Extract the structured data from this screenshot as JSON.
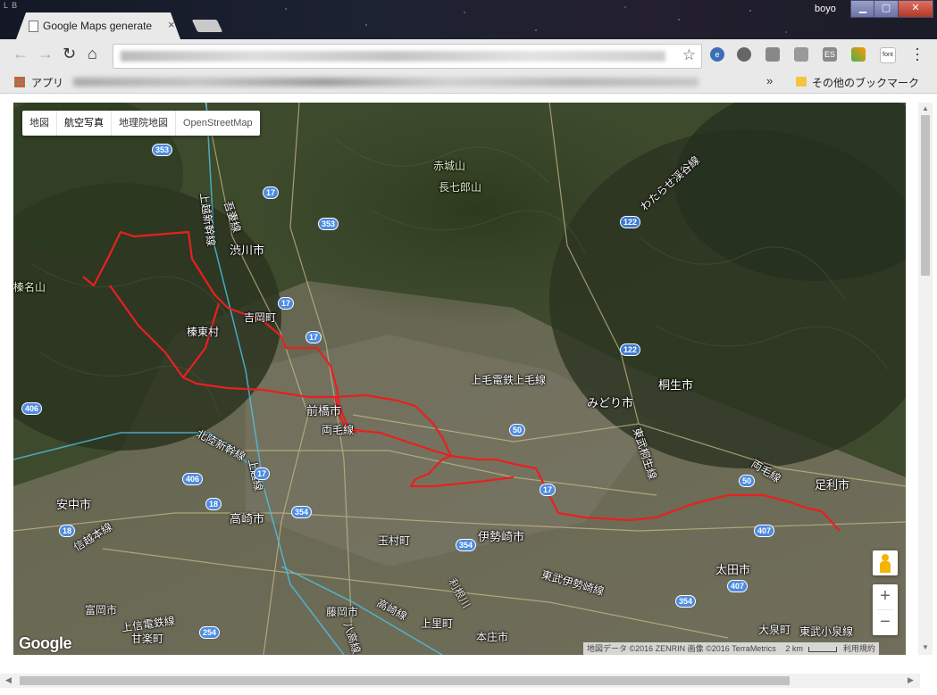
{
  "window": {
    "user": "boyo",
    "tab_title": "Google Maps generate",
    "tab_close": "×",
    "minimize": "▁",
    "maximize": "▢",
    "close": "✕"
  },
  "toolbar": {
    "back": "←",
    "forward": "→",
    "reload": "↻",
    "home": "⌂",
    "star": "☆",
    "ext_e": "e",
    "ext_es": "ES",
    "ext_font": "font"
  },
  "bookmarks": {
    "apps": "アプリ",
    "more": "»",
    "other": "その他のブックマーク"
  },
  "map": {
    "types": [
      "地図",
      "航空写真",
      "地理院地図",
      "OpenStreetMap"
    ],
    "selected_type": "航空写真",
    "google": "Google",
    "zoom_in": "+",
    "zoom_out": "−",
    "attribution": "地図データ ©2016 ZENRIN 画像 ©2016 TerraMetrics",
    "scale": "2 km",
    "terms": "利用規約",
    "labels": {
      "akagi": "赤城山",
      "nanashiro": "長七郎山",
      "haruna": "榛名山",
      "shibukawa": "渋川市",
      "yoshioka": "吉岡町",
      "shinto": "榛東村",
      "maebashi": "前橋市",
      "takasaki": "高崎市",
      "isesaki": "伊勢崎市",
      "midori": "みどり市",
      "kiryu": "桐生市",
      "ashikaga": "足利市",
      "ota": "太田市",
      "annaka": "安中市",
      "tomioka": "富岡市",
      "fujioka": "藤岡市",
      "tamamura": "玉村町",
      "honjo": "本庄市",
      "kamisato": "上里町",
      "kanra": "甘楽町",
      "oizumi": "大泉町",
      "jomo": "上毛電鉄上毛線",
      "ryomo_line": "両毛線",
      "ryomo_line2": "両毛線",
      "joetsu_line": "上越新幹線",
      "joetsu_line2": "上越線",
      "hokuriku": "北陸新幹線",
      "agatsuma": "吾妻線",
      "shinetsu": "信越本線",
      "joshin": "上信電鉄線",
      "takasaki_line": "高崎線",
      "tobu_isesaki": "東武伊勢崎線",
      "tobu_kiryu": "東武桐生線",
      "tobu_koizumi": "東武小泉線",
      "watarase": "わたらせ渓谷線",
      "hachiko": "八高線",
      "tone": "利根川"
    },
    "routes": [
      "353",
      "17",
      "353",
      "17",
      "17",
      "122",
      "122",
      "406",
      "406",
      "50",
      "50",
      "18",
      "18",
      "354",
      "354",
      "17",
      "407",
      "407",
      "354",
      "254",
      "17"
    ],
    "route_color": "#e82020"
  }
}
